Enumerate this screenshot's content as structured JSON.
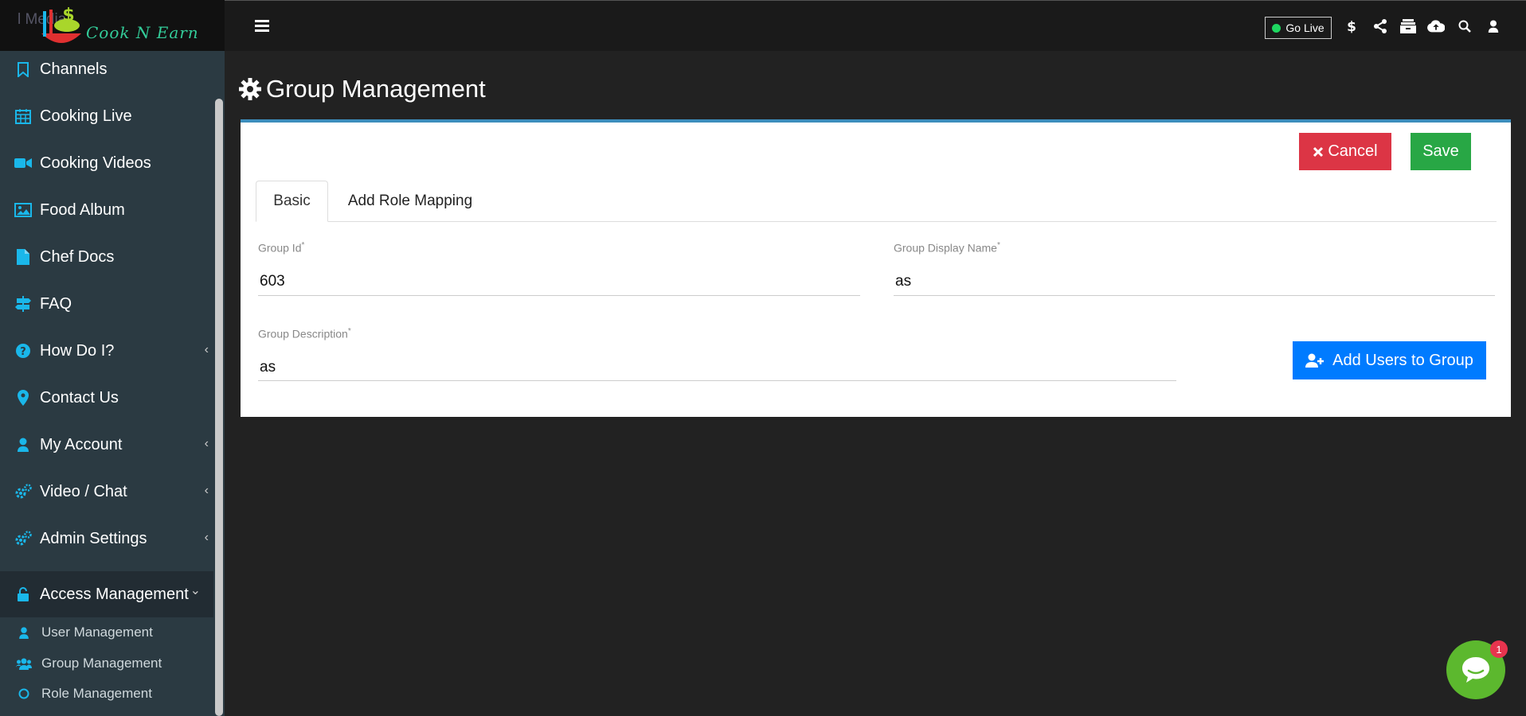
{
  "brand": {
    "logo_text": "Cook N Earn",
    "ghost_text": "l Media"
  },
  "sidebar": {
    "items": [
      {
        "label": "Channels",
        "icon": "bookmark-icon"
      },
      {
        "label": "Cooking Live",
        "icon": "calendar-icon"
      },
      {
        "label": "Cooking Videos",
        "icon": "video-camera-icon"
      },
      {
        "label": "Food Album",
        "icon": "image-icon"
      },
      {
        "label": "Chef Docs",
        "icon": "file-icon"
      },
      {
        "label": "FAQ",
        "icon": "signpost-icon"
      },
      {
        "label": "How Do I?",
        "icon": "question-circle-icon",
        "chevron": "‹"
      },
      {
        "label": "Contact Us",
        "icon": "map-marker-icon"
      },
      {
        "label": "My Account",
        "icon": "user-icon",
        "chevron": "‹"
      },
      {
        "label": "Video / Chat",
        "icon": "cogs-icon",
        "chevron": "‹"
      },
      {
        "label": "Admin Settings",
        "icon": "cogs-icon",
        "chevron": "‹"
      },
      {
        "label": "Access Management",
        "icon": "unlock-icon",
        "chevron": "⌄"
      }
    ],
    "sub_items": [
      {
        "label": "User Management",
        "icon": "user-icon"
      },
      {
        "label": "Group Management",
        "icon": "users-icon"
      },
      {
        "label": "Role Management",
        "icon": "circle-icon"
      }
    ]
  },
  "topbar": {
    "go_live": "Go Live",
    "icons": [
      "dollar-icon",
      "share-icon",
      "archive-icon",
      "cloud-upload-icon",
      "search-icon",
      "user-icon"
    ]
  },
  "page": {
    "title": "Group Management",
    "cancel_label": "Cancel",
    "save_label": "Save",
    "tabs": [
      "Basic",
      "Add Role Mapping"
    ],
    "fields": {
      "group_id": {
        "label": "Group Id",
        "value": "603",
        "required": "*"
      },
      "group_display_name": {
        "label": "Group Display Name",
        "value": "as",
        "required": "*"
      },
      "group_description": {
        "label": "Group Description",
        "value": "as",
        "required": "*"
      }
    },
    "add_users_label": "Add Users to Group"
  },
  "chat": {
    "badge_count": "1"
  },
  "colors": {
    "accent": "#1ab7ea",
    "cancel": "#dc3545",
    "save": "#28a745",
    "primary": "#007bff",
    "chat": "#5cb82e"
  }
}
